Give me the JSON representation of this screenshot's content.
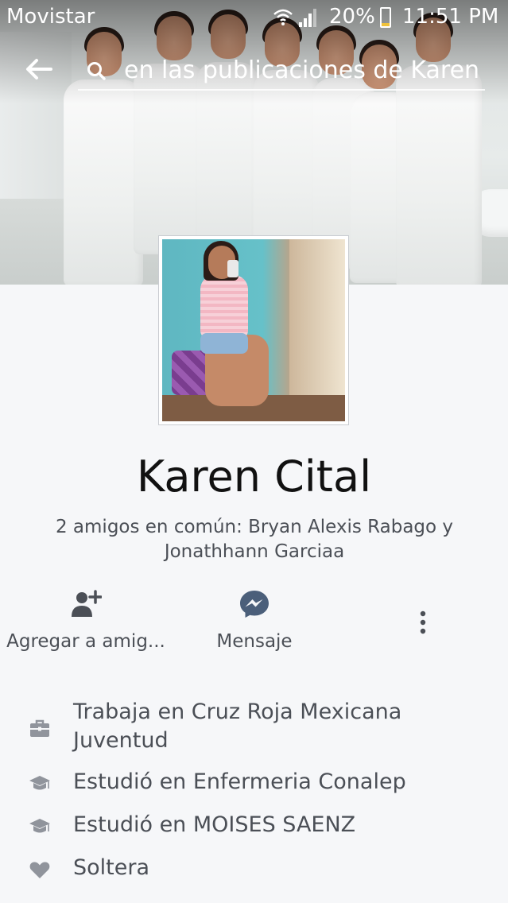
{
  "status_bar": {
    "carrier": "Movistar",
    "battery_percent": "20%",
    "battery_level": 0.2,
    "time": "11:51 PM",
    "icons": [
      "wifi-icon",
      "signal-icon",
      "battery-icon"
    ]
  },
  "header": {
    "back_icon": "back-arrow-icon",
    "search_icon": "search-icon",
    "search_placeholder": "en las publicaciones de Karen"
  },
  "profile": {
    "name": "Karen Cital",
    "mutual_friends": "2 amigos en común: Bryan Alexis Rabago y Jonathhann Garciaa"
  },
  "actions": [
    {
      "label": "Agregar a amig...",
      "icon": "add-friend-icon"
    },
    {
      "label": "Mensaje",
      "icon": "messenger-icon"
    },
    {
      "label": "",
      "icon": "more-options-icon"
    }
  ],
  "about": [
    {
      "text": "Trabaja en Cruz Roja Mexicana Juventud",
      "icon": "briefcase-icon"
    },
    {
      "text": "Estudió en Enfermeria Conalep",
      "icon": "graduation-cap-icon"
    },
    {
      "text": "Estudió en MOISES SAENZ",
      "icon": "graduation-cap-icon"
    },
    {
      "text": "Soltera",
      "icon": "heart-icon"
    }
  ],
  "colors": {
    "icon_gray": "#90949c",
    "text_secondary": "#4b4f56",
    "background": "#f6f7f9",
    "messenger_icon": "#4b5f7a"
  }
}
